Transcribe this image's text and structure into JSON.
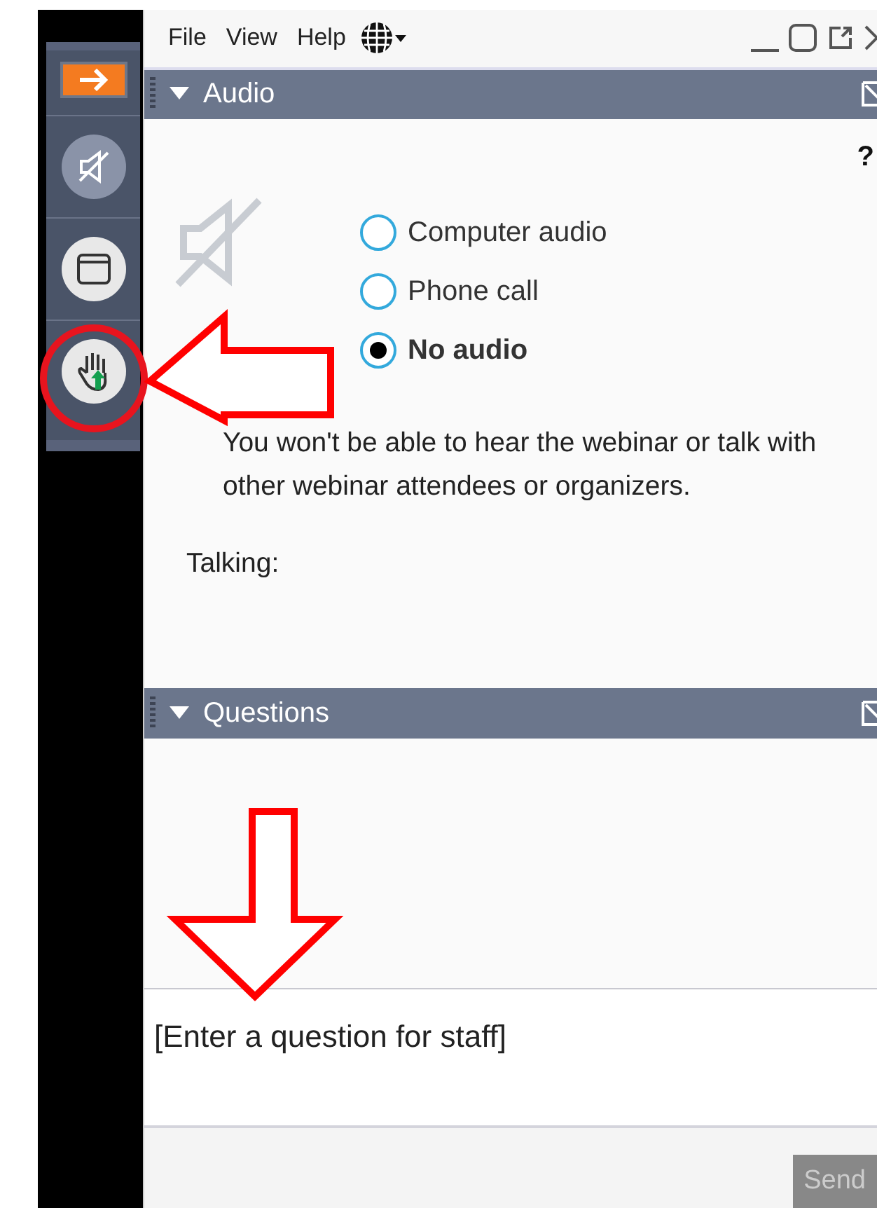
{
  "menu": [
    {
      "label": "File"
    },
    {
      "label": "View"
    },
    {
      "label": "Help"
    }
  ],
  "audio": {
    "title": "Audio",
    "expanded": true,
    "help": "?",
    "options": [
      {
        "label": "Computer audio",
        "selected": false
      },
      {
        "label": "Phone call",
        "selected": false
      },
      {
        "label": "No audio",
        "selected": true
      }
    ],
    "note": "You won't be able to hear the webinar or talk with other webinar attendees or organizers.",
    "talking_label": "Talking:"
  },
  "questions": {
    "title": "Questions",
    "expanded": true,
    "placeholder": "[Enter a question for staff]",
    "send": {
      "label": "Send",
      "disabled": true
    }
  }
}
